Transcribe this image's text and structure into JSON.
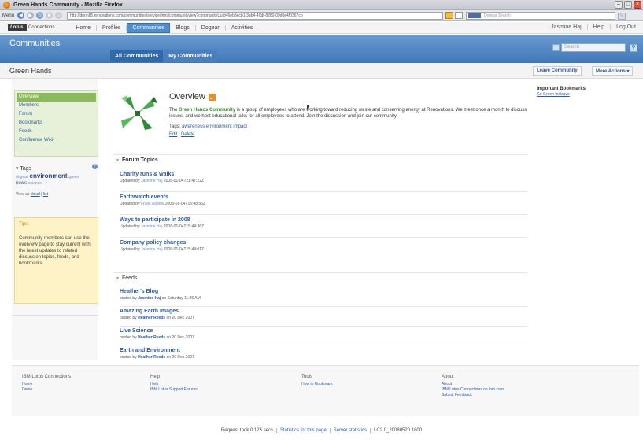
{
  "browser": {
    "window_title": "Green Hands Community - Mozilla Firefox",
    "menu_label": "Menu",
    "url": "http://donn85.renovations.com/communities/service/html/communityview?communityUuid=6eb3ecb1-3ab4-40df-8280-09d0e4f0367cb",
    "search_placeholder": "Dogear Search"
  },
  "topbar": {
    "logo_text": "Lotus.",
    "logo_word": "Connections",
    "nav": [
      "Home",
      "Profiles",
      "Communities",
      "Blogs",
      "Dogear",
      "Activities"
    ],
    "user_name": "Jasmine Haj",
    "help_label": "Help",
    "logout_label": "Log Out"
  },
  "band": {
    "title": "Communities",
    "tabs": [
      "All Communities",
      "My Communities"
    ],
    "search_placeholder": "Search"
  },
  "community": {
    "name": "Green Hands",
    "leave_label": "Leave Community",
    "more_label": "More Actions ▾"
  },
  "sidebar": {
    "nav": [
      "Overview",
      "Members",
      "Forum",
      "Bookmarks",
      "Feeds",
      "Confluence Wiki"
    ],
    "tags_label": "▾ Tags",
    "tags": {
      "t1": "dogear",
      "t2": "environment",
      "t3": "green",
      "t4": "news",
      "t5": "science"
    },
    "view_as_label": "View as",
    "view_cloud": "cloud",
    "view_list": "list",
    "tips_title": "Tips",
    "tips_body": "Community members can use the overview page to stay current with the latest updates to related discussion topics, feeds, and bookmarks."
  },
  "overview": {
    "title": "Overview",
    "desc_prefix": "The ",
    "desc_name": "Green Hands Community",
    "desc_rest": " is a group of employees who are working toward reducing waste and conserving energy at Renovations. We meet once a month to discuss issues, and we host educational talks for all employees to attend. Join the discussion and join our community!",
    "tags_label": "Tags:",
    "tags": "awareness  environment  impact",
    "edit_label": "Edit",
    "delete_label": "Delete"
  },
  "forum": {
    "heading": "Forum Topics",
    "topics": [
      {
        "title": "Charity runs & walks",
        "updated_by": "Updated by",
        "who": "Jasmine Haj",
        "when": "2008-01-04T21:47:22Z"
      },
      {
        "title": "Earthwatch events",
        "updated_by": "Updated by",
        "who": "Frank Adams",
        "when": "2008-01-04T15:48:55Z"
      },
      {
        "title": "Ways to participate in 2008",
        "updated_by": "Updated by",
        "who": "Jasmine Haj",
        "when": "2008-01-04T15:44:36Z"
      },
      {
        "title": "Company policy changes",
        "updated_by": "Updated by",
        "who": "Jasmine Haj",
        "when": "2008-01-04T15:44:01Z"
      }
    ]
  },
  "feeds": {
    "heading": "Feeds",
    "items": [
      {
        "title": "Heather's Blog",
        "posted_by": "posted by",
        "who": "Jasmine Haj",
        "on": "on Saturday 11:26 AM"
      },
      {
        "title": "Amazing Earth Images",
        "posted_by": "posted by",
        "who": "Heather Reeds",
        "on": "on 20 Dec 2007"
      },
      {
        "title": "Live Science",
        "posted_by": "posted by",
        "who": "Heather Reeds",
        "on": "on 20 Dec 2007"
      },
      {
        "title": "Earth and Environment",
        "posted_by": "posted by",
        "who": "Heather Reeds",
        "on": "on 20 Dec 2007"
      }
    ]
  },
  "right": {
    "title": "Important Bookmarks",
    "link": "Go Green Initiative"
  },
  "footer": {
    "col1": {
      "heading": "IBM Lotus Connections",
      "links": [
        "Home",
        "Demo"
      ]
    },
    "col2": {
      "heading": "Help",
      "links": [
        "Help",
        "IBM Lotus Support Forums"
      ]
    },
    "col3": {
      "heading": "Tools",
      "links": [
        "How to Bookmark"
      ]
    },
    "col4": {
      "heading": "About",
      "links": [
        "About",
        "IBM Lotus Connections on ibm.com",
        "Submit Feedback"
      ]
    }
  },
  "status": {
    "request": "Request took 0.125 secs",
    "stats": "Statistics for this page",
    "server": "Server statistics",
    "build": "LC2.0_20080520 1800"
  },
  "colors": {
    "band": "#3f78b8",
    "link": "#2a5aa0",
    "nav_active": "#8cba5a",
    "tips_bg": "#fdf3c6"
  }
}
